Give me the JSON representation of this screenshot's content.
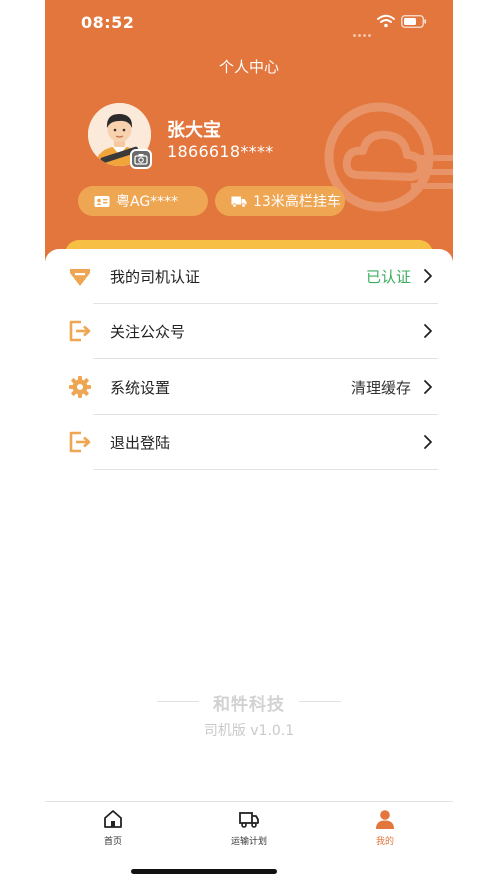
{
  "status_bar": {
    "time": "08:52",
    "icons": [
      "signal-icon",
      "wifi-icon",
      "battery-icon"
    ]
  },
  "header": {
    "title": "个人中心",
    "background_color": "#e2763d",
    "watermark_icon": "cloud-logo-icon"
  },
  "profile": {
    "avatar_icon": "driver-avatar-icon",
    "camera_icon": "camera-icon",
    "name": "张大宝",
    "phone": "1866618****"
  },
  "tags": {
    "plate": {
      "icon": "id-card-icon",
      "label": "粤AG****"
    },
    "vehicle": {
      "icon": "truck-icon",
      "label": "13米高栏挂车"
    }
  },
  "menu": [
    {
      "icon": "verified-badge-icon",
      "label": "我的司机认证",
      "value": "已认证"
    },
    {
      "icon": "exit-icon",
      "label": "关注公众号",
      "value": ""
    },
    {
      "icon": "gear-icon",
      "label": "系统设置",
      "value": "清理缓存"
    },
    {
      "icon": "exit-icon",
      "label": "退出登陆",
      "value": ""
    }
  ],
  "colors": {
    "accent": "#e2763d",
    "pill": "#eea653",
    "strip": "#f7c044",
    "verified": "#3cae5f"
  },
  "footer": {
    "brand": "和牪科技",
    "version": "司机版 v1.0.1"
  },
  "tabbar": {
    "items": [
      {
        "icon": "home-icon",
        "label": "首页",
        "active": false
      },
      {
        "icon": "truck-icon",
        "label": "运输计划",
        "active": false
      },
      {
        "icon": "user-icon",
        "label": "我的",
        "active": true
      }
    ]
  }
}
